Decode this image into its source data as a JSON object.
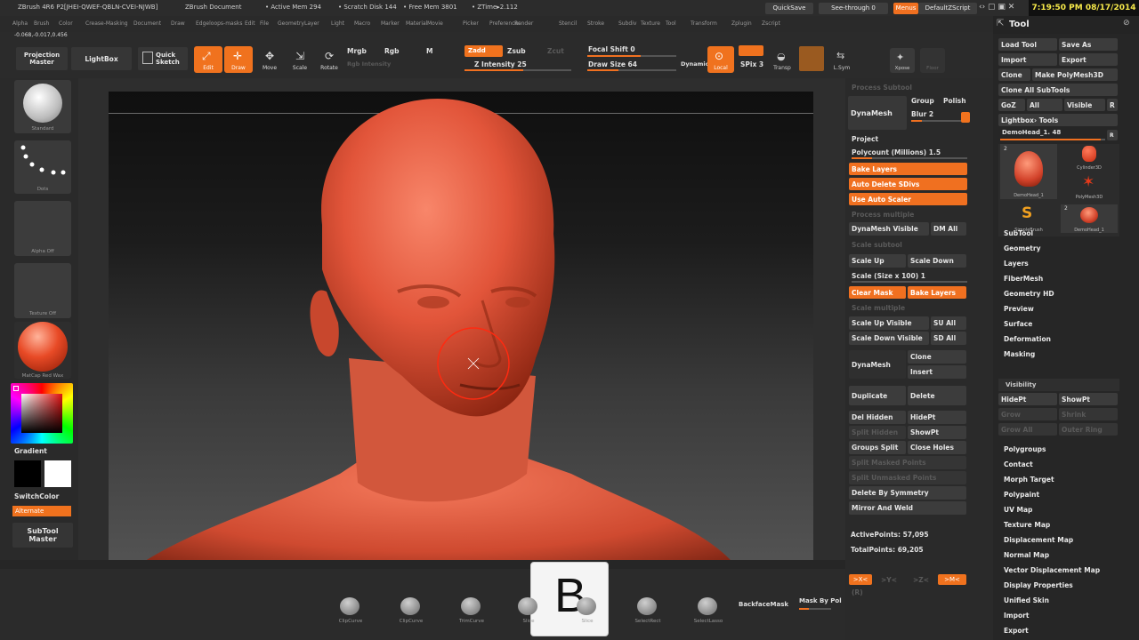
{
  "titlebar": {
    "app": "ZBrush 4R6 P2[JHEI-QWEF-QBLN-CVEI-NJWB]",
    "doc": "ZBrush Document",
    "active_mem": "• Active Mem 294",
    "scratch": "• Scratch Disk 144",
    "free_mem": "• Free Mem 3801",
    "ztime": "• ZTime▸2.112",
    "quicksave": "QuickSave",
    "seethrough": "See-through  0",
    "menus": "Menus",
    "defaultzscript": "DefaultZScript",
    "clock": "7:19:50 PM 08/17/2014"
  },
  "menubar": [
    "Alpha",
    "Brush",
    "Color",
    "Document",
    "Draw",
    "Edit",
    "File",
    "Layer",
    "Light",
    "Macro",
    "Marker",
    "Material",
    "Movie",
    "Picker",
    "Preferences",
    "Render",
    "Stencil",
    "Stroke",
    "Texture",
    "Tool",
    "Transform",
    "Zplugin",
    "Zscript"
  ],
  "submenubar": [
    "Alpha",
    "Brush",
    "Color",
    "Crease-Masking",
    "Document",
    "Draw",
    "Edgeloops-masks",
    "Edit",
    "File",
    "Geometry",
    "Layer",
    "Light",
    "Macro",
    "Marker",
    "Material",
    "Movie",
    "Picker",
    "Preferences",
    "Render",
    "Stencil",
    "Stroke",
    "Subdiv",
    "Texture",
    "Tool",
    "Transform",
    "Zplugin",
    "Zscript"
  ],
  "coords": "-0.068,-0.017,0.456",
  "toolbar": {
    "projection_master": "Projection Master",
    "lightbox": "LightBox",
    "quick_sketch": "Quick Sketch",
    "edit": "Edit",
    "draw": "Draw",
    "move": "Move",
    "scale": "Scale",
    "rotate": "Rotate",
    "mrgb": "Mrgb",
    "rgb": "Rgb",
    "m": "M",
    "rgb_intensity": "Rgb Intensity",
    "zadd": "Zadd",
    "zsub": "Zsub",
    "zcut": "Zcut",
    "z_intensity": "Z Intensity 25",
    "focal_shift": "Focal Shift 0",
    "draw_size": "Draw Size 64",
    "dynamic": "Dynamic",
    "active_points_label": "Local",
    "spix": "SPix 3",
    "transp": "Transp",
    "lsym": "L.Sym",
    "xpose": "Xpose",
    "floor": "Floor"
  },
  "leftshelf": {
    "brush": "Standard",
    "stroke": "Dots",
    "alpha": "Alpha Off",
    "texture": "Texture Off",
    "material": "MatCap Red Wax",
    "gradient": "Gradient",
    "switchcolor": "SwitchColor",
    "alternate": "Alternate",
    "subtool_master": "SubTool Master"
  },
  "rightpanel": {
    "process_subtool": "Process Subtool",
    "dynamesh": "DynaMesh",
    "group": "Group",
    "polish": "Polish",
    "blur": "Blur 2",
    "project": "Project",
    "polycount": "Polycount (Millions) 1.5",
    "bake_layers": "Bake Layers",
    "auto_delete": "Auto Delete SDivs",
    "use_auto_scaler": "Use Auto Scaler",
    "process_multiple": "Process multiple",
    "dynamesh_visible": "DynaMesh Visible",
    "dm_all": "DM All",
    "scale_subtool": "Scale subtool",
    "scale_up": "Scale Up",
    "scale_down": "Scale Down",
    "scale_size": "Scale (Size x 100) 1",
    "clear_mask": "Clear Mask",
    "bake_layers2": "Bake Layers",
    "scale_multiple": "Scale multiple",
    "scale_up_visible": "Scale Up Visible",
    "su_all": "SU All",
    "scale_down_visible": "Scale Down Visible",
    "sd_all": "SD All",
    "dynamesh2": "DynaMesh",
    "clone": "Clone",
    "insert": "Insert",
    "duplicate": "Duplicate",
    "delete": "Delete",
    "del_hidden": "Del Hidden",
    "hidept": "HidePt",
    "split_hidden": "Split Hidden",
    "showpt": "ShowPt",
    "groups_split": "Groups Split",
    "close_holes": "Close Holes",
    "split_masked": "Split Masked Points",
    "split_unmasked": "Split Unmasked Points",
    "delete_by_symmetry": "Delete By Symmetry",
    "mirror_and_weld": "Mirror And Weld",
    "active_points": "ActivePoints: 57,095",
    "total_points": "TotalPoints: 69,205",
    "sym_x": ">X<",
    "sym_y": ">Y<",
    "sym_z": ">Z<",
    "sym_m": ">M<",
    "sym_r": "(R)"
  },
  "toolpalette": {
    "title": "Tool",
    "load_tool": "Load Tool",
    "save_as": "Save As",
    "import": "Import",
    "export": "Export",
    "clone": "Clone",
    "make_polymesh": "Make PolyMesh3D",
    "clone_all": "Clone All SubTools",
    "goz": "GoZ",
    "all": "All",
    "visible": "Visible",
    "r": "R",
    "lightbox_tools": "Lightbox› Tools",
    "current_tool": "DemoHead_1. 48",
    "thumbs": [
      "DemoHead_1",
      "Cylinder3D",
      "PolyMesh3D",
      "SimpleBrush",
      "DemoHead_1"
    ],
    "thumb_counts": [
      "2",
      "2"
    ],
    "menu": [
      "SubTool",
      "Geometry",
      "Layers",
      "FiberMesh",
      "Geometry HD",
      "Preview",
      "Surface",
      "Deformation",
      "Masking"
    ],
    "visibility": "Visibility",
    "vis_hidept": "HidePt",
    "vis_showpt": "ShowPt",
    "vis_grow": "Grow",
    "vis_shrink": "Shrink",
    "vis_growall": "Grow All",
    "vis_outerring": "Outer Ring",
    "menu2": [
      "Polygroups",
      "Contact",
      "Morph Target",
      "Polypaint",
      "UV Map",
      "Texture Map",
      "Displacement Map",
      "Normal Map",
      "Vector Displacement Map",
      "Display Properties",
      "Unified Skin",
      "Import",
      "Export"
    ]
  },
  "bottom": {
    "brushes": [
      "ClipCurve",
      "ClipCurve",
      "TrimCurve",
      "Slice",
      "Slice",
      "SelectRect",
      "SelectLasso"
    ],
    "backface": "BackfaceMask",
    "mask_by_pol": "Mask By Pol",
    "key_overlay": "B"
  },
  "colors": {
    "accent": "#f07020",
    "skin": "#e05a40",
    "panel": "#2a2a2a"
  }
}
